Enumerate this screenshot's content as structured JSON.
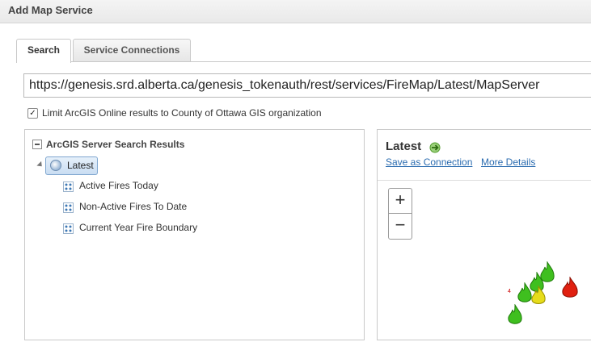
{
  "window": {
    "title": "Add Map Service"
  },
  "tabs": [
    {
      "label": "Search",
      "active": true
    },
    {
      "label": "Service Connections",
      "active": false
    }
  ],
  "url_input": {
    "value": "https://genesis.srd.alberta.ca/genesis_tokenauth/rest/services/FireMap/Latest/MapServer"
  },
  "limit_checkbox": {
    "checked": true,
    "label": "Limit ArcGIS Online results to County of Ottawa GIS organization"
  },
  "results": {
    "root_label": "ArcGIS Server Search Results",
    "service": {
      "label": "Latest",
      "icon": "globe-icon"
    },
    "layers": [
      {
        "label": "Active Fires Today",
        "icon": "layer-icon"
      },
      {
        "label": "Non-Active Fires To Date",
        "icon": "layer-icon"
      },
      {
        "label": "Current Year Fire Boundary",
        "icon": "layer-icon"
      }
    ]
  },
  "preview": {
    "title": "Latest",
    "title_icon": "connect-arrow-icon",
    "save_link": "Save as Connection",
    "details_link": "More Details",
    "zoom_in": "+",
    "zoom_out": "−",
    "map_label": "4",
    "fire_icons": [
      {
        "color": "green"
      },
      {
        "color": "green"
      },
      {
        "color": "green"
      },
      {
        "color": "yellow"
      },
      {
        "color": "green"
      },
      {
        "color": "red"
      }
    ]
  },
  "colors": {
    "link": "#2b6cb0",
    "fire_green": "#3fbf1f",
    "fire_yellow": "#e6dc1a",
    "fire_red": "#e02010"
  }
}
